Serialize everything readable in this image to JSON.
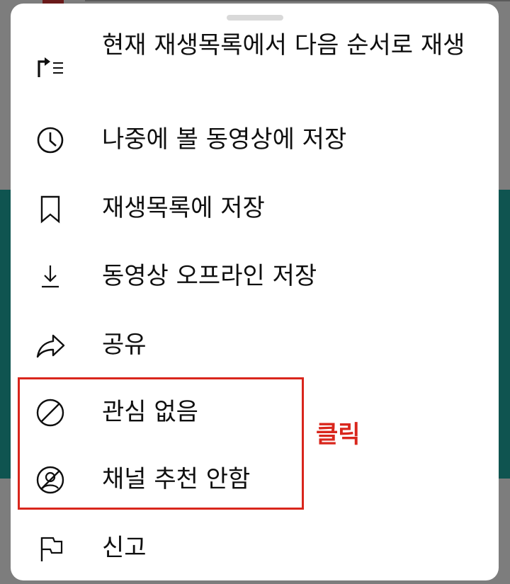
{
  "menu": {
    "items": [
      {
        "id": "play-next",
        "icon": "play-next-queue-icon",
        "label": "현재 재생목록에서 다음 순서로 재생"
      },
      {
        "id": "watch-later",
        "icon": "clock-icon",
        "label": "나중에 볼 동영상에 저장"
      },
      {
        "id": "save-playlist",
        "icon": "bookmark-icon",
        "label": "재생목록에 저장"
      },
      {
        "id": "download",
        "icon": "download-icon",
        "label": "동영상 오프라인 저장"
      },
      {
        "id": "share",
        "icon": "share-icon",
        "label": "공유"
      },
      {
        "id": "not-interested",
        "icon": "block-icon",
        "label": "관심 없음"
      },
      {
        "id": "dont-recommend",
        "icon": "channel-block-icon",
        "label": "채널 추천 안함"
      },
      {
        "id": "report",
        "icon": "flag-icon",
        "label": "신고"
      }
    ]
  },
  "annotation": {
    "text": "클릭",
    "color": "#d9261c"
  },
  "colors": {
    "sheet_bg": "#ffffff",
    "text": "#0f0f0f",
    "overlay_teal": "#0f5450"
  }
}
